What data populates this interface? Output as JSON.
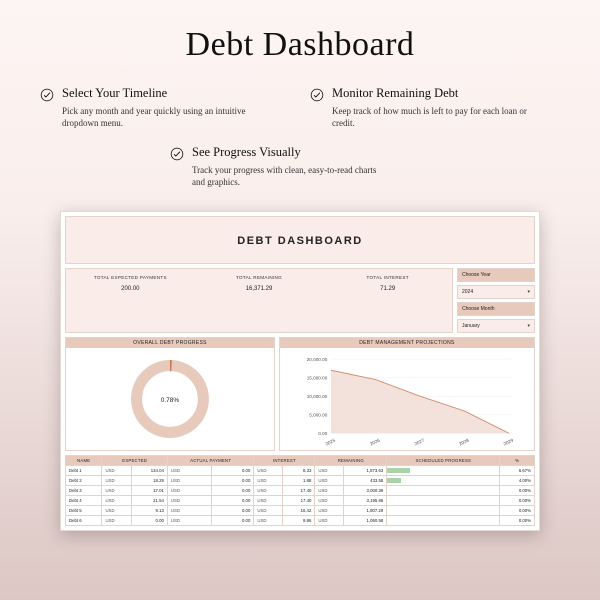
{
  "page": {
    "title": "Debt Dashboard"
  },
  "features": [
    {
      "title": "Select Your Timeline",
      "desc": "Pick any month and year quickly using an intuitive dropdown menu."
    },
    {
      "title": "Monitor Remaining Debt",
      "desc": "Keep track of how much is left to pay for each loan or credit."
    },
    {
      "title": "See Progress Visually",
      "desc": "Track your progress with clean, easy-to-read charts and graphics."
    }
  ],
  "dashboard": {
    "title": "DEBT DASHBOARD",
    "totals": [
      {
        "label": "TOTAL EXPECTED PAYMENTS",
        "value": "200.00"
      },
      {
        "label": "TOTAL REMAINING",
        "value": "16,371.29"
      },
      {
        "label": "TOTAL INTEREST",
        "value": "71.29"
      }
    ],
    "selectors": {
      "year": {
        "label": "Choose Year",
        "value": "2024"
      },
      "month": {
        "label": "Choose Month",
        "value": "January"
      }
    },
    "donut": {
      "title": "OVERALL DEBT PROGRESS",
      "center_value": "0.78%"
    },
    "line_chart": {
      "title": "DEBT MANAGEMENT PROJECTIONS"
    },
    "table": {
      "headers": [
        "NAME",
        "",
        "EXPECTED",
        "",
        "ACTUAL PAYMENT",
        "",
        "INTEREST",
        "",
        "REMAINING",
        "SCHEDULED PROGRESS",
        "%"
      ],
      "rows": [
        {
          "name": "Debt 1",
          "exp_cur": "USD",
          "exp": "134.04",
          "act_cur": "USD",
          "act": "0.00",
          "int_cur": "USD",
          "int": "8.33",
          "rem_cur": "USD",
          "rem": "1,873.63",
          "pct": "6.67%",
          "bar": 0.2
        },
        {
          "name": "Debt 2",
          "exp_cur": "USD",
          "exp": "18.29",
          "act_cur": "USD",
          "act": "0.00",
          "int_cur": "USD",
          "int": "1.88",
          "rem_cur": "USD",
          "rem": "433.55",
          "pct": "4.00%",
          "bar": 0.12
        },
        {
          "name": "Debt 3",
          "exp_cur": "USD",
          "exp": "17.01",
          "act_cur": "USD",
          "act": "0.00",
          "int_cur": "USD",
          "int": "17.40",
          "rem_cur": "USD",
          "rem": "3,000.39",
          "pct": "0.00%",
          "bar": 0.0
        },
        {
          "name": "Debt 4",
          "exp_cur": "USD",
          "exp": "21.54",
          "act_cur": "USD",
          "act": "0.00",
          "int_cur": "USD",
          "int": "17.40",
          "rem_cur": "USD",
          "rem": "3,195.86",
          "pct": "0.00%",
          "bar": 0.0
        },
        {
          "name": "Debt 5",
          "exp_cur": "USD",
          "exp": "9.13",
          "act_cur": "USD",
          "act": "0.00",
          "int_cur": "USD",
          "int": "16.42",
          "rem_cur": "USD",
          "rem": "1,807.29",
          "pct": "0.00%",
          "bar": 0.0
        },
        {
          "name": "Debt 6",
          "exp_cur": "USD",
          "exp": "0.00",
          "act_cur": "USD",
          "act": "0.00",
          "int_cur": "USD",
          "int": "9.86",
          "rem_cur": "USD",
          "rem": "1,060.58",
          "pct": "0.00%",
          "bar": 0.0
        }
      ]
    }
  },
  "chart_data": {
    "type": "line",
    "title": "Debt Management Projections",
    "x": [
      2025,
      2026,
      2027,
      2028,
      2029
    ],
    "y": [
      17000,
      14500,
      10000,
      6000,
      0
    ],
    "y_ticks": [
      0,
      5000,
      10000,
      15000,
      20000
    ],
    "ylim": [
      0,
      20000
    ]
  }
}
